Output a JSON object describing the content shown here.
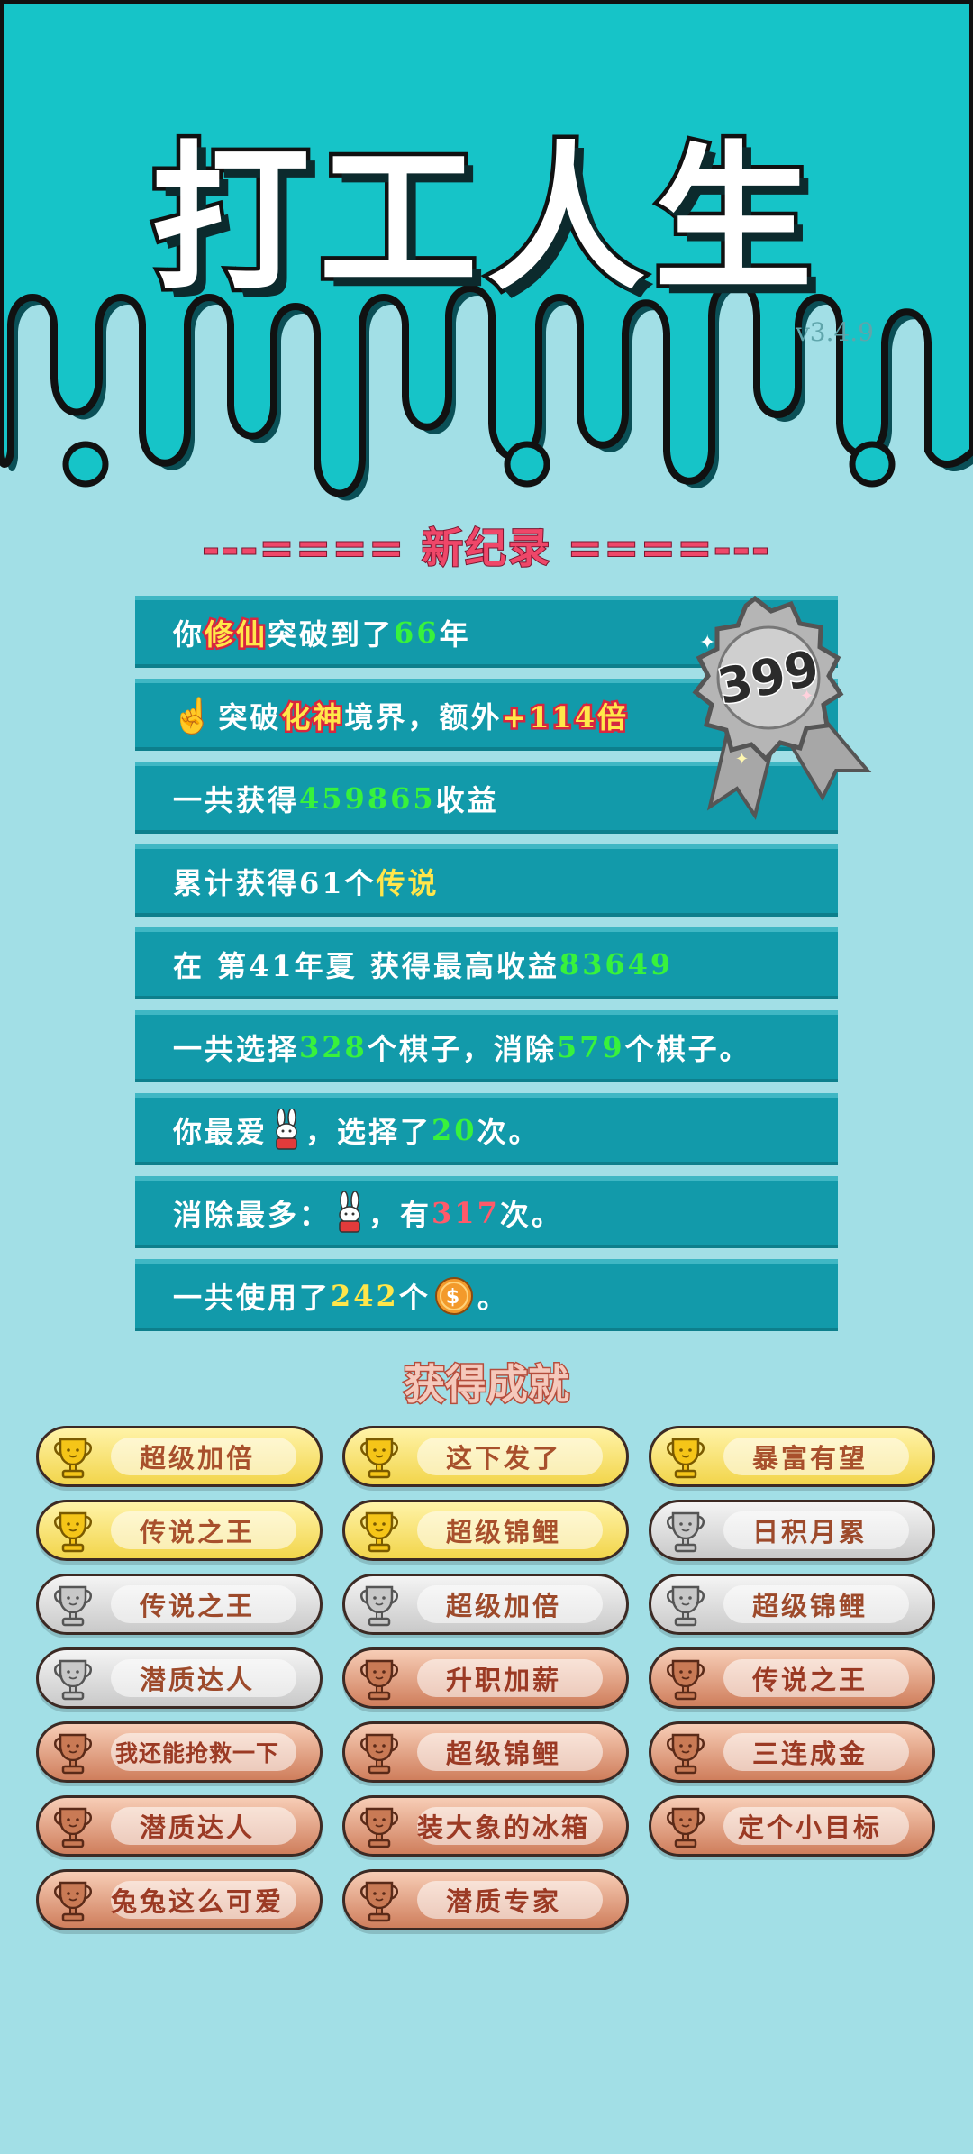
{
  "app": {
    "title": "打工人生",
    "version": "v3.4.9"
  },
  "colors": {
    "header_teal": "#16c4c8",
    "background": "#a2dfe6",
    "row_teal": "#129aaa",
    "green": "#38f23c",
    "yellow": "#ffe64a",
    "red": "#ff5a6a"
  },
  "record": {
    "title": "---==== 新纪录 ====---",
    "badge_score": "399",
    "rows": {
      "r1": {
        "a": "你",
        "hl": "修仙",
        "b": "突破到了",
        "v": "66",
        "c": "年"
      },
      "r2": {
        "a": "突破",
        "hl": "化神",
        "b": "境界，额外",
        "v": "+114倍"
      },
      "r3": {
        "a": "一共获得",
        "v": "459865",
        "b": "收益"
      },
      "r4": {
        "a": "累计获得61个",
        "v": "传说"
      },
      "r5": {
        "a": "在 第41年夏 获得最高收益",
        "v": "83649"
      },
      "r6": {
        "a": "一共选择",
        "v1": "328",
        "b": "个棋子，消除",
        "v2": "579",
        "c": "个棋子。"
      },
      "r7": {
        "a": "你最爱",
        "b": "，选择了",
        "v": "20",
        "c": "次。"
      },
      "r8": {
        "a": "消除最多：",
        "b": "，有",
        "v": "317",
        "c": "次。"
      },
      "r9": {
        "a": "一共使用了",
        "v": "242",
        "b": "个",
        "c": "。"
      }
    }
  },
  "achievements": {
    "title": "获得成就",
    "items": [
      {
        "label": "超级加倍",
        "tier": "gold"
      },
      {
        "label": "这下发了",
        "tier": "gold"
      },
      {
        "label": "暴富有望",
        "tier": "gold"
      },
      {
        "label": "传说之王",
        "tier": "gold"
      },
      {
        "label": "超级锦鲤",
        "tier": "gold"
      },
      {
        "label": "日积月累",
        "tier": "silver"
      },
      {
        "label": "传说之王",
        "tier": "silver"
      },
      {
        "label": "超级加倍",
        "tier": "silver"
      },
      {
        "label": "超级锦鲤",
        "tier": "silver"
      },
      {
        "label": "潜质达人",
        "tier": "silver"
      },
      {
        "label": "升职加薪",
        "tier": "bronze"
      },
      {
        "label": "传说之王",
        "tier": "bronze"
      },
      {
        "label": "我还能抢救一下",
        "tier": "bronze"
      },
      {
        "label": "超级锦鲤",
        "tier": "bronze"
      },
      {
        "label": "三连成金",
        "tier": "bronze"
      },
      {
        "label": "潜质达人",
        "tier": "bronze"
      },
      {
        "label": "装大象的冰箱",
        "tier": "bronze"
      },
      {
        "label": "定个小目标",
        "tier": "bronze"
      },
      {
        "label": "兔兔这么可爱",
        "tier": "bronze"
      },
      {
        "label": "潜质专家",
        "tier": "bronze"
      }
    ]
  },
  "icons": {
    "hand": "pointing-hand-icon",
    "bunny": "bunny-icon",
    "coin": "coin-icon",
    "trophy": "trophy-icon",
    "badge": "rosette-badge-icon"
  }
}
